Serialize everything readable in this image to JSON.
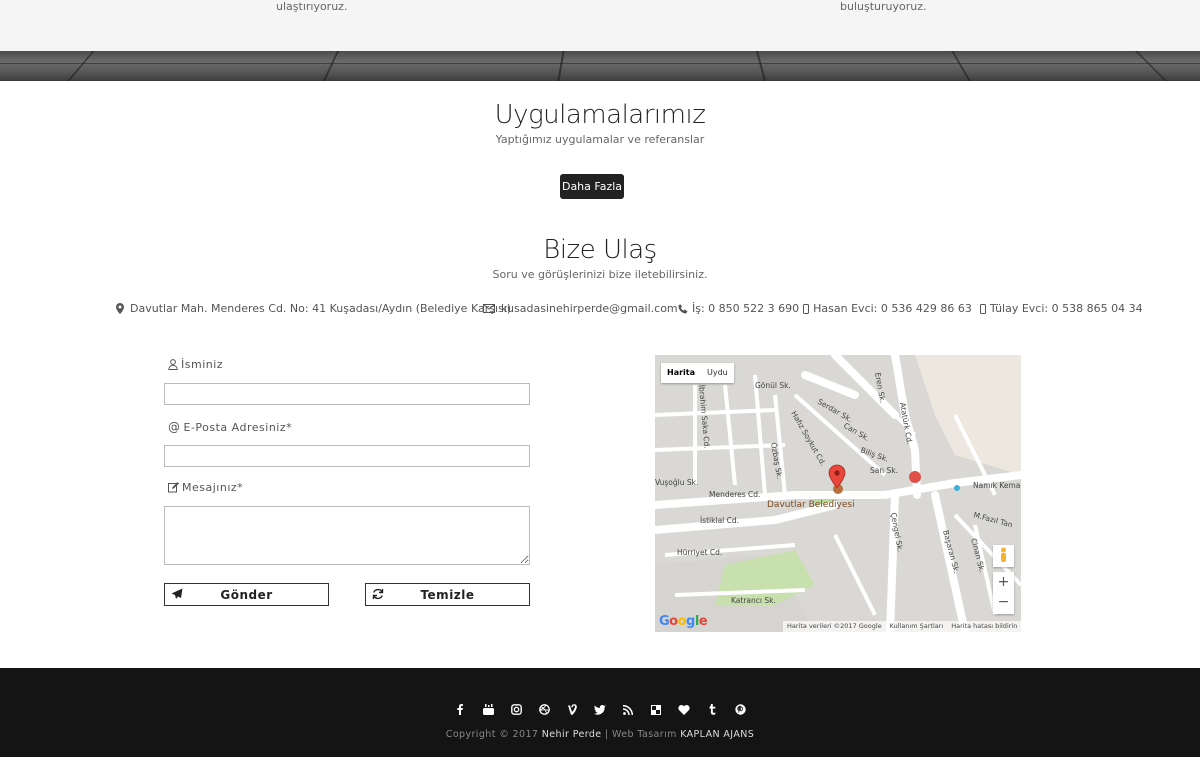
{
  "top_strip": {
    "left_text": "ulaştırıyoruz.",
    "right_text": "buluşturuyoruz."
  },
  "applications": {
    "title": "Uygulamalarımız",
    "subtitle": "Yaptığımız uygulamalar ve referanslar",
    "more_button": "Daha Fazla"
  },
  "contact": {
    "title": "Bize Ulaş",
    "subtitle": "Soru ve görüşlerinizi bize iletebilirsiniz.",
    "address": "Davutlar Mah. Menderes Cd. No: 41 Kuşadası/Aydın (Belediye Karşısı)",
    "email": "kusadasinehirperde@gmail.com",
    "phone_work": "İş: 0 850 522 3 690",
    "phone_hasan": "Hasan Evci: 0 536 429 86 63",
    "phone_tulay": "Tülay Evci: 0 538 865 04 34"
  },
  "form": {
    "name_label": "İsminiz",
    "name_value": "",
    "email_label": "E-Posta Adresiniz*",
    "email_value": "",
    "message_label": "Mesajınız*",
    "message_value": "",
    "send_button": "Gönder",
    "clear_button": "Temizle"
  },
  "map": {
    "tab_map": "Harita",
    "tab_satellite": "Uydu",
    "marker_label": "Davutlar Belediyesi",
    "streets": [
      "Gönül Sk.",
      "Atatürk Cd.",
      "Eren Sk.",
      "Serdar Sk.",
      "Can Sk.",
      "Biliş Sk.",
      "San Sk.",
      "Hafız Soykut Cd.",
      "İbrahim Saka Cd.",
      "Özbaş Sk.",
      "Menderes Cd.",
      "Vuşoğlu Sk.",
      "İstiklal Cd.",
      "Hürriyet Cd.",
      "Katrancı Sk.",
      "Çengel Sk.",
      "Başaran Sk.",
      "Namık Kemal",
      "M.Fazıl Tan",
      "Cinan Sk."
    ],
    "zoom_in": "+",
    "zoom_out": "−",
    "logo": "Google",
    "footer_data": "Harita verileri ©2017 Google",
    "footer_terms": "Kullanım Şartları",
    "footer_report": "Harita hatası bildirin"
  },
  "footer": {
    "social_icons": [
      "facebook-icon",
      "youtube-icon",
      "instagram-icon",
      "dribbble-icon",
      "vine-icon",
      "twitter-icon",
      "rss-icon",
      "delicious-icon",
      "heart-icon",
      "tumblr-icon",
      "pinterest-icon"
    ],
    "copyright_prefix": "Copyright © 2017",
    "brand": "Nehir Perde",
    "separator": "| Web Tasarım",
    "agency": "KAPLAN AJANS"
  }
}
